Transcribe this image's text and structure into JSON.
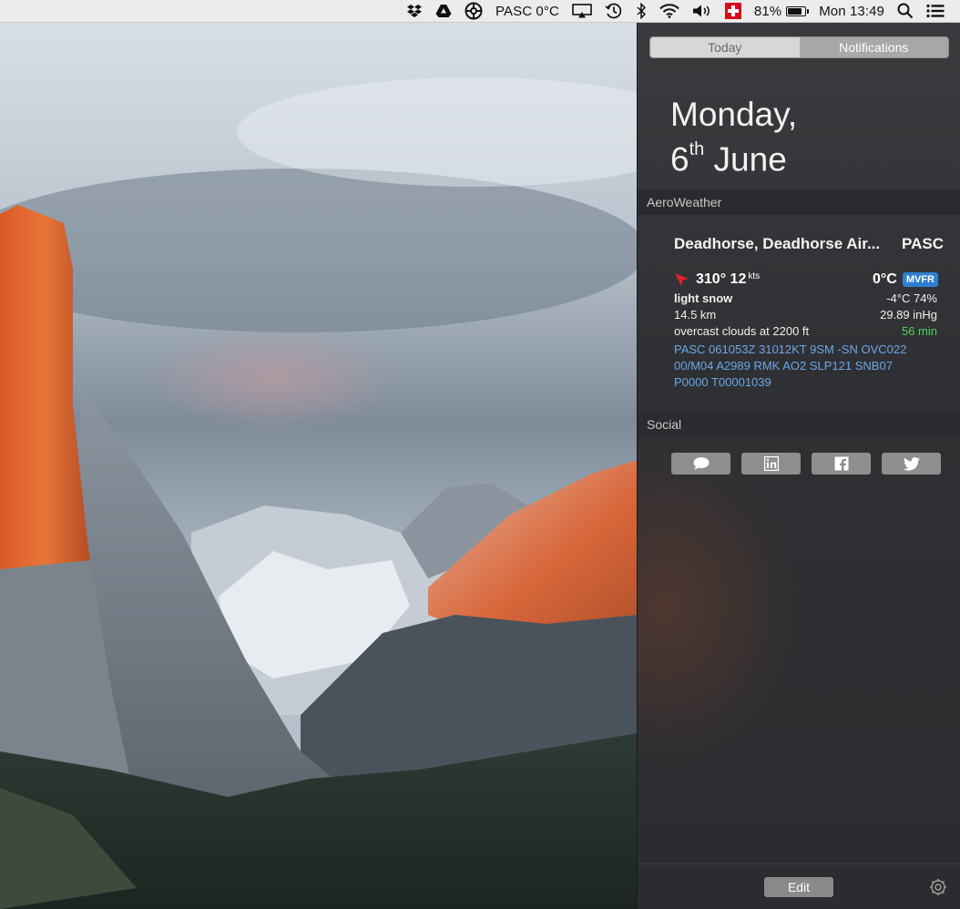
{
  "menubar": {
    "weather_label": "PASC 0°C",
    "battery_percent": "81%",
    "battery_level": 0.81,
    "clock": "Mon 13:49",
    "icons": [
      "dropbox-icon",
      "google-drive-icon",
      "aperture-icon",
      "airplay-icon",
      "time-machine-icon",
      "bluetooth-icon",
      "wifi-icon",
      "volume-icon",
      "swiss-flag-icon",
      "battery-icon",
      "spotlight-search-icon",
      "notification-center-icon"
    ]
  },
  "notification_center": {
    "tabs": [
      {
        "label": "Today"
      },
      {
        "label": "Notifications"
      }
    ],
    "date": {
      "weekday": "Monday,",
      "day": "6",
      "suffix": "th",
      "month": "June"
    },
    "aeroweather": {
      "header": "AeroWeather",
      "station_name": "Deadhorse, Deadhorse Air...",
      "station_code": "PASC",
      "wind": "310° 12",
      "wind_unit": "kts",
      "temperature": "0°C",
      "flight_category": "MVFR",
      "flight_category_color": "#2f7fd0",
      "condition": "light snow",
      "dewpoint_humidity": "-4°C 74%",
      "visibility": "14.5 km",
      "pressure": "29.89 inHg",
      "clouds": "overcast clouds at 2200 ft",
      "age": "56 min",
      "metar_lines": [
        "PASC 061053Z 31012KT 9SM -SN OVC022",
        "00/M04 A2989 RMK AO2 SLP121 SNB07",
        "P0000 T00001039"
      ]
    },
    "social": {
      "header": "Social",
      "buttons": [
        "messages-icon",
        "linkedin-icon",
        "facebook-icon",
        "twitter-icon"
      ]
    },
    "footer": {
      "edit_label": "Edit"
    }
  }
}
